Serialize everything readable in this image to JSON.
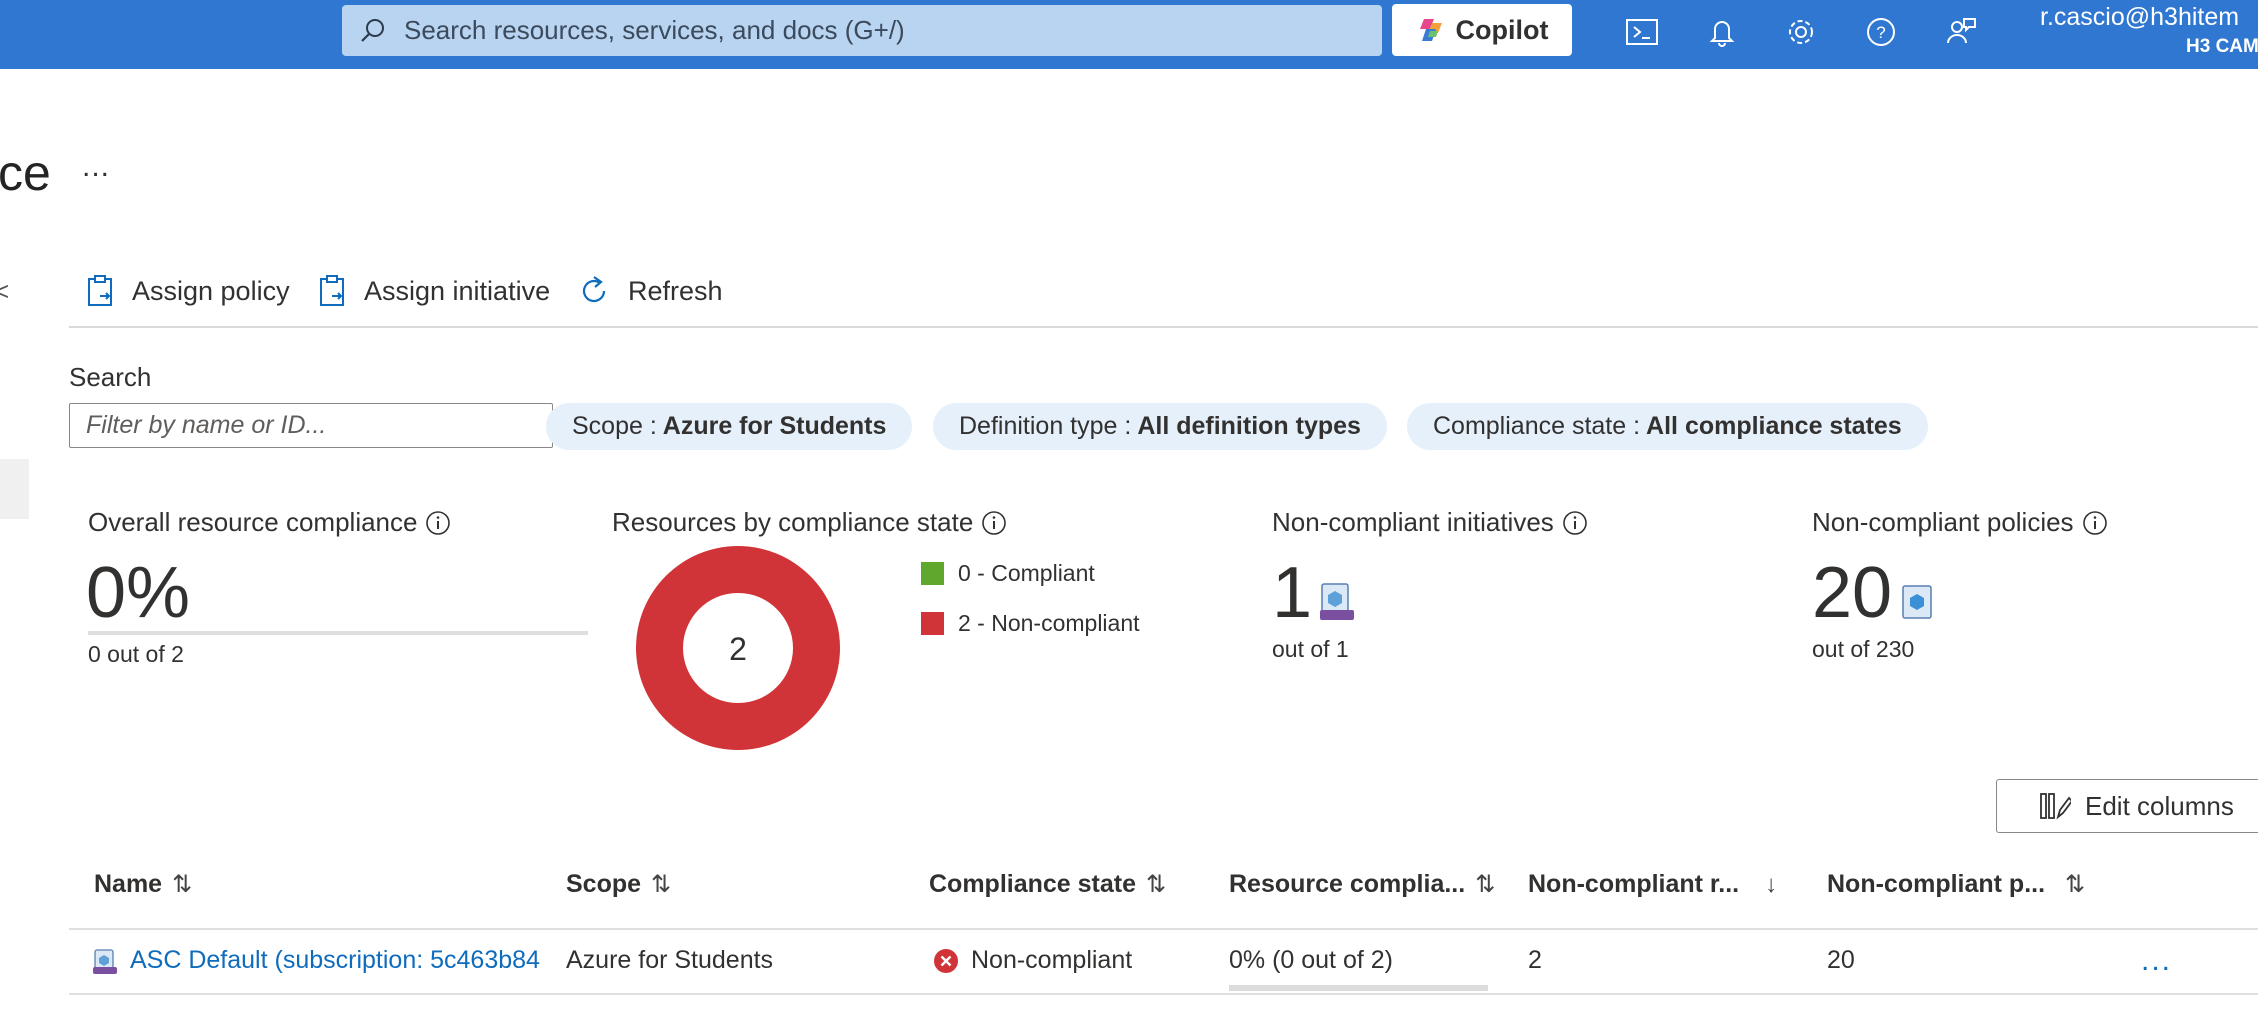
{
  "topbar": {
    "search_placeholder": "Search resources, services, and docs (G+/)",
    "copilot_label": "Copilot",
    "user_name": "r.cascio@h3hitem",
    "user_org": "H3 CAM",
    "icons": [
      "cloud-shell-icon",
      "notifications-icon",
      "settings-icon",
      "help-icon",
      "feedback-icon"
    ],
    "background_color": "#2f77d0"
  },
  "page": {
    "title_fragment": "ce",
    "more_label": "...",
    "collapse_fragment": "<"
  },
  "toolbar": {
    "assign_policy": "Assign policy",
    "assign_initiative": "Assign initiative",
    "refresh": "Refresh"
  },
  "filters": {
    "search_label": "Search",
    "search_placeholder": "Filter by name or ID...",
    "scope_key": "Scope :",
    "scope_value": "Azure for Students",
    "deftype_key": "Definition type :",
    "deftype_value": "All definition types",
    "state_key": "Compliance state :",
    "state_value": "All compliance states"
  },
  "summary": {
    "overall_title": "Overall resource compliance",
    "overall_value": "0%",
    "overall_fraction": 0,
    "overall_sub": "0 out of 2",
    "by_state_title": "Resources by compliance state",
    "donut_center": "2",
    "legend_compliant": "0 - Compliant",
    "legend_noncompliant": "2 - Non-compliant",
    "compliant_color": "#5fa72d",
    "noncompliant_color": "#d13438",
    "initiatives_title": "Non-compliant initiatives",
    "initiatives_value": "1",
    "initiatives_out_of": "out of 1",
    "policies_title": "Non-compliant policies",
    "policies_value": "20",
    "policies_out_of": "out of 230"
  },
  "chart_data": {
    "type": "pie",
    "categories": [
      "Compliant",
      "Non-compliant"
    ],
    "values": [
      0,
      2
    ],
    "colors": [
      "#5fa72d",
      "#d13438"
    ]
  },
  "table": {
    "edit_columns": "Edit columns",
    "columns": [
      "Name",
      "Scope",
      "Compliance state",
      "Resource complia...",
      "Non-compliant r...",
      "Non-compliant p..."
    ],
    "sort_icons": [
      "⇅",
      "⇅",
      "⇅",
      "⇅",
      "↓",
      "⇅"
    ],
    "rows": [
      {
        "name": "ASC Default (subscription: 5c463b84",
        "scope": "Azure for Students",
        "state": "Non-compliant",
        "resource_compliance": "0% (0 out of 2)",
        "compliance_fraction": 0,
        "noncompliant_resources": "2",
        "noncompliant_policies": "20",
        "more": "..."
      }
    ]
  }
}
